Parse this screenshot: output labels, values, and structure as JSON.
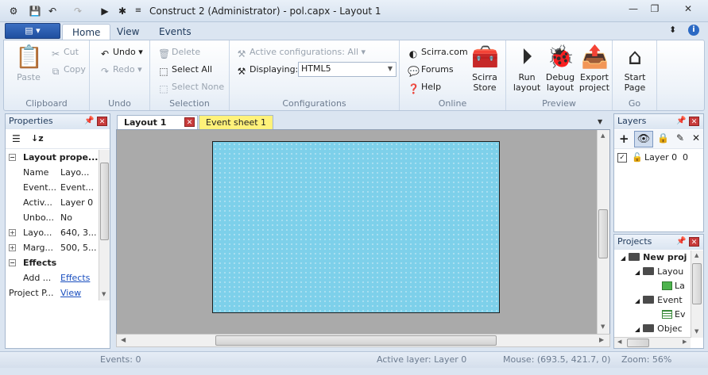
{
  "window": {
    "title": "Construct 2 (Administrator) - pol.capx - Layout 1",
    "minimize_glyph": "—",
    "restore_glyph": "❐",
    "close_glyph": "✕"
  },
  "quick_access": [
    "gear-icon",
    "save-icon",
    "undo-icon",
    "redo-icon",
    "run-icon",
    "debug-icon",
    "customize-icon"
  ],
  "ribbon": {
    "app_menu_glyph": "▤ ▾",
    "tabs": [
      {
        "label": "Home",
        "active": true
      },
      {
        "label": "View",
        "active": false
      },
      {
        "label": "Events",
        "active": false
      }
    ],
    "clipboard": {
      "label": "Clipboard",
      "paste": "Paste",
      "cut": "Cut",
      "copy": "Copy"
    },
    "undo": {
      "label": "Undo",
      "undo": "Undo",
      "redo": "Redo"
    },
    "selection": {
      "label": "Selection",
      "delete": "Delete",
      "select_all": "Select All",
      "select_none": "Select None"
    },
    "configurations": {
      "label": "Configurations",
      "active": "Active configurations: All",
      "displaying_label": "Displaying:",
      "displaying_value": "HTML5"
    },
    "online": {
      "label": "Online",
      "scirra": "Scirra.com",
      "forums": "Forums",
      "help": "Help",
      "store_line1": "Scirra",
      "store_line2": "Store"
    },
    "preview": {
      "label": "Preview",
      "run_line1": "Run",
      "run_line2": "layout",
      "debug_line1": "Debug",
      "debug_line2": "layout",
      "export_line1": "Export",
      "export_line2": "project"
    },
    "go": {
      "label": "Go",
      "start_line1": "Start",
      "start_line2": "Page"
    }
  },
  "properties": {
    "title": "Properties",
    "section_layout": "Layout prope...",
    "rows": [
      {
        "key": "Name",
        "value": "Layo..."
      },
      {
        "key": "Event...",
        "value": "Event..."
      },
      {
        "key": "Activ...",
        "value": "Layer 0"
      },
      {
        "key": "Unbo...",
        "value": "No"
      }
    ],
    "expand_rows": [
      {
        "key": "Layo...",
        "value": "640, 3..."
      },
      {
        "key": "Marg...",
        "value": "500, 5..."
      }
    ],
    "section_effects": "Effects",
    "add_key": "Add ...",
    "add_link": "Effects",
    "project_key": "Project P...",
    "project_link": "View"
  },
  "documents": {
    "tab_layout": "Layout 1",
    "tab_events": "Event sheet 1"
  },
  "layers": {
    "title": "Layers",
    "row_name": "Layer 0",
    "row_index": "0"
  },
  "projects": {
    "title": "Projects",
    "root": "New proj",
    "layouts_folder": "Layou",
    "layout_item": "La",
    "events_folder": "Event",
    "event_item": "Ev",
    "objects_folder": "Objec"
  },
  "status": {
    "events": "Events: 0",
    "active_layer": "Active layer: Layer 0",
    "mouse": "Mouse: (693.5, 421.7, 0)",
    "zoom": "Zoom: 56%"
  },
  "colors": {
    "layout_fill": "#7dd0ea",
    "event_tab": "#fff27a",
    "canvas_bg": "#aaaaaa"
  }
}
